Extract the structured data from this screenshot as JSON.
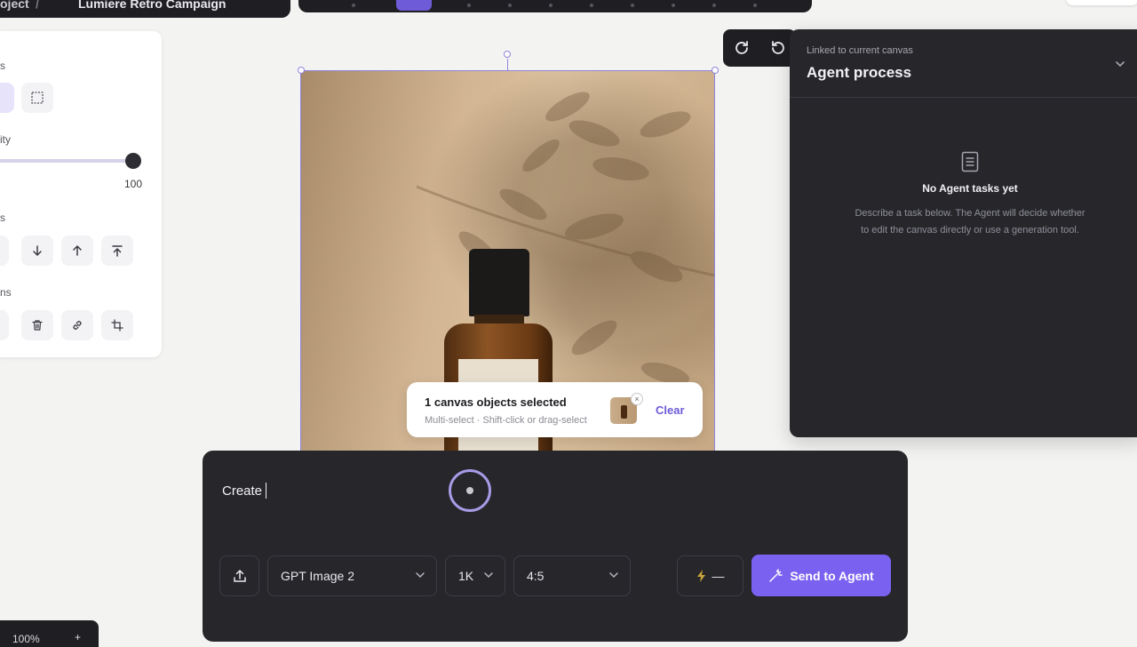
{
  "topbar": {
    "project_label": "oject",
    "separator": "/",
    "campaign_title": "Lumiere Retro Campaign"
  },
  "left_panel": {
    "section_style_label": "s",
    "section_opacity_label": "ity",
    "opacity_value": "100",
    "opacity_level": 1.0,
    "section_arrange_label": "s",
    "section_actions_label": "ns"
  },
  "canvas": {
    "selected_image": "amber-bottle-photo"
  },
  "selection_chip": {
    "title": "1 canvas objects selected",
    "subtitle": "Multi-select · Shift-click or drag-select",
    "remove_glyph": "×",
    "clear_label": "Clear"
  },
  "agent_panel": {
    "linked_label": "Linked to current canvas",
    "title": "Agent process",
    "empty_title": "No Agent tasks yet",
    "empty_description": "Describe a task below. The Agent will decide whether to edit the canvas directly or use a generation tool."
  },
  "composer": {
    "prompt_text": "Create",
    "model": "GPT Image 2",
    "resolution": "1K",
    "aspect_ratio": "4:5",
    "credits": "—",
    "send_label": "Send to Agent"
  },
  "zoom": {
    "value": "100%",
    "plus_label": "+"
  },
  "colors": {
    "accent": "#7b61f0",
    "dark_panel": "#26262b",
    "canvas_bg": "#f3f3f1"
  }
}
